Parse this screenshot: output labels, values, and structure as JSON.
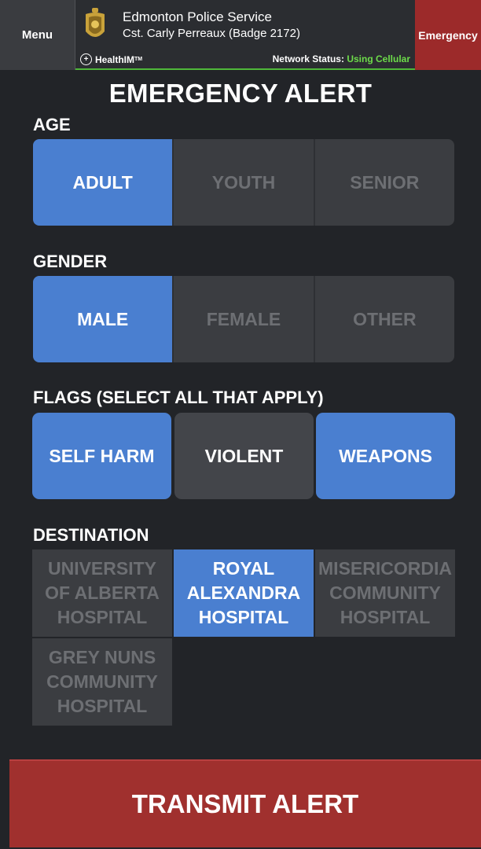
{
  "header": {
    "menu_label": "Menu",
    "org_name": "Edmonton Police Service",
    "officer": "Cst. Carly Perreaux (Badge 2172)",
    "brand": "HealthIM",
    "network_label": "Network Status:",
    "network_value": "Using Cellular",
    "emergency_label": "Emergency"
  },
  "title": "EMERGENCY ALERT",
  "age": {
    "label": "AGE",
    "options": [
      "ADULT",
      "YOUTH",
      "SENIOR"
    ],
    "selected": "ADULT"
  },
  "gender": {
    "label": "GENDER",
    "options": [
      "MALE",
      "FEMALE",
      "OTHER"
    ],
    "selected": "MALE"
  },
  "flags": {
    "label": "FLAGS (SELECT ALL THAT APPLY)",
    "options": [
      "SELF HARM",
      "VIOLENT",
      "WEAPONS"
    ],
    "selected": [
      "SELF HARM",
      "WEAPONS"
    ]
  },
  "destination": {
    "label": "DESTINATION",
    "options": [
      "UNIVERSITY\nOF ALBERTA\nHOSPITAL",
      "ROYAL\nALEXANDRA\nHOSPITAL",
      "MISERICORDIA\nCOMMUNITY\nHOSPITAL",
      "GREY NUNS\nCOMMUNITY\nHOSPITAL"
    ],
    "selected": "ROYAL\nALEXANDRA\nHOSPITAL"
  },
  "transmit_label": "TRANSMIT ALERT",
  "colors": {
    "selected": "#4a7fd0",
    "emergency": "#9c2a2a",
    "network_ok": "#6ddc4a"
  }
}
